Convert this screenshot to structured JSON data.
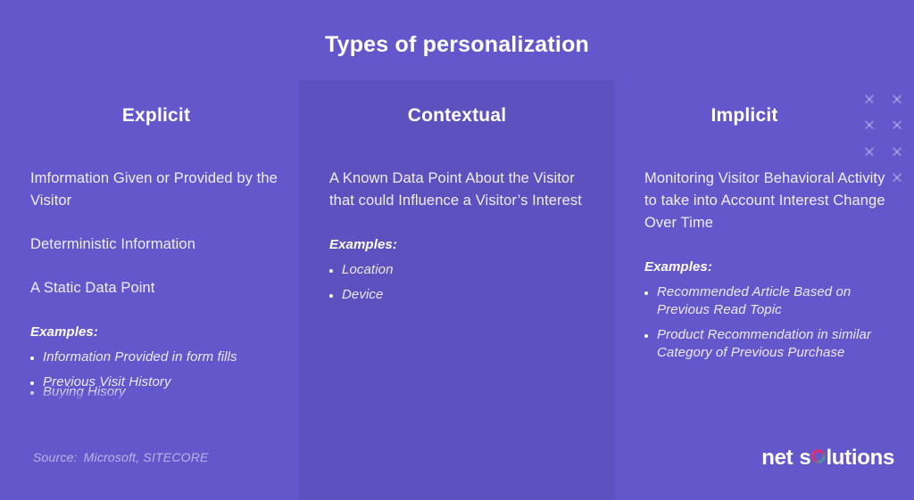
{
  "title": "Types of personalization",
  "colors": {
    "background": "#6457cb",
    "panel": "#5d50bf",
    "text": "#ffffff",
    "muted": "rgba(255,255,255,0.55)"
  },
  "columns": [
    {
      "id": "explicit",
      "heading": "Explicit",
      "statements": [
        "Imformation Given or Provided by the Visitor",
        "Deterministic Information",
        "A Static Data Point"
      ],
      "examples_label": "Examples:",
      "examples": [
        "Information Provided in form fills",
        "Previous Visit History"
      ],
      "clipped_example": "Buying Hisory"
    },
    {
      "id": "contextual",
      "heading": "Contextual",
      "statements": [
        "A Known Data Point About the Visitor that could Influence a Visitor’s Interest"
      ],
      "examples_label": "Examples:",
      "examples": [
        "Location",
        "Device"
      ],
      "clipped_example": ""
    },
    {
      "id": "implicit",
      "heading": "Implicit",
      "statements": [
        "Monitoring Visitor Behavioral Activity to take into Account Interest Change Over Time"
      ],
      "examples_label": "Examples:",
      "examples": [
        "Recommended Article Based on Previous Read Topic",
        "Product Recommendation in similar Category of Previous Purchase"
      ],
      "clipped_example": ""
    }
  ],
  "source": {
    "label": "Source:",
    "value": "Microsoft, SITECORE"
  },
  "logo": {
    "part1": "net",
    "part2": "s",
    "ring_icon": "logo-ring-icon",
    "part3": "lutions",
    "ring_colors": [
      "#e8336e",
      "#1fb5ae",
      "#7b2d8e"
    ]
  },
  "decoration": {
    "x_icon": "x-mark-icon",
    "x_pattern": [
      [
        true,
        true
      ],
      [
        true,
        true
      ],
      [
        true,
        true
      ],
      [
        false,
        true
      ]
    ]
  }
}
